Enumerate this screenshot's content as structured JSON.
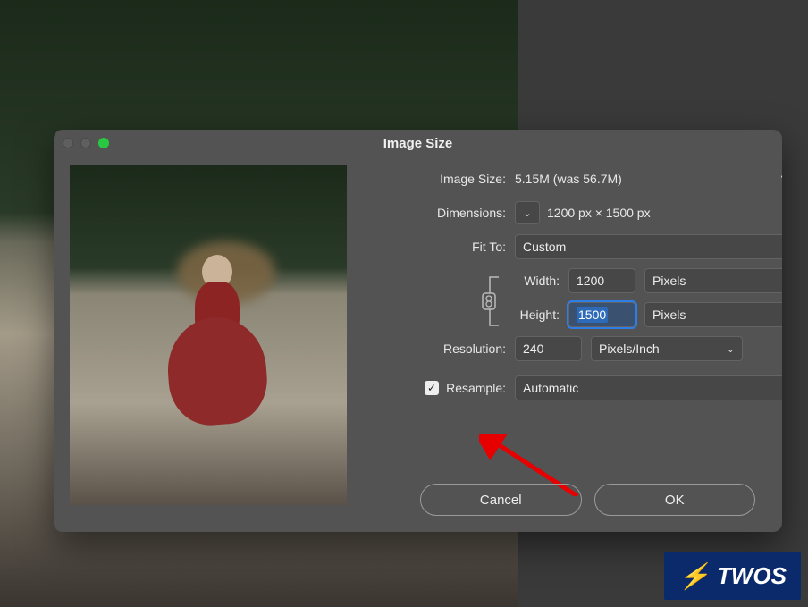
{
  "dialog": {
    "title": "Image Size",
    "imageSizeLabel": "Image Size:",
    "imageSizeValue": "5.15M (was 56.7M)",
    "dimensionsLabel": "Dimensions:",
    "dimensionsValue": "1200 px × 1500 px",
    "fitToLabel": "Fit To:",
    "fitToValue": "Custom",
    "widthLabel": "Width:",
    "widthValue": "1200",
    "widthUnit": "Pixels",
    "heightLabel": "Height:",
    "heightValue": "1500",
    "heightUnit": "Pixels",
    "resolutionLabel": "Resolution:",
    "resolutionValue": "240",
    "resolutionUnit": "Pixels/Inch",
    "resampleLabel": "Resample:",
    "resampleChecked": true,
    "resampleMethod": "Automatic",
    "cancelLabel": "Cancel",
    "okLabel": "OK"
  },
  "watermark": {
    "text": "TWOS"
  }
}
